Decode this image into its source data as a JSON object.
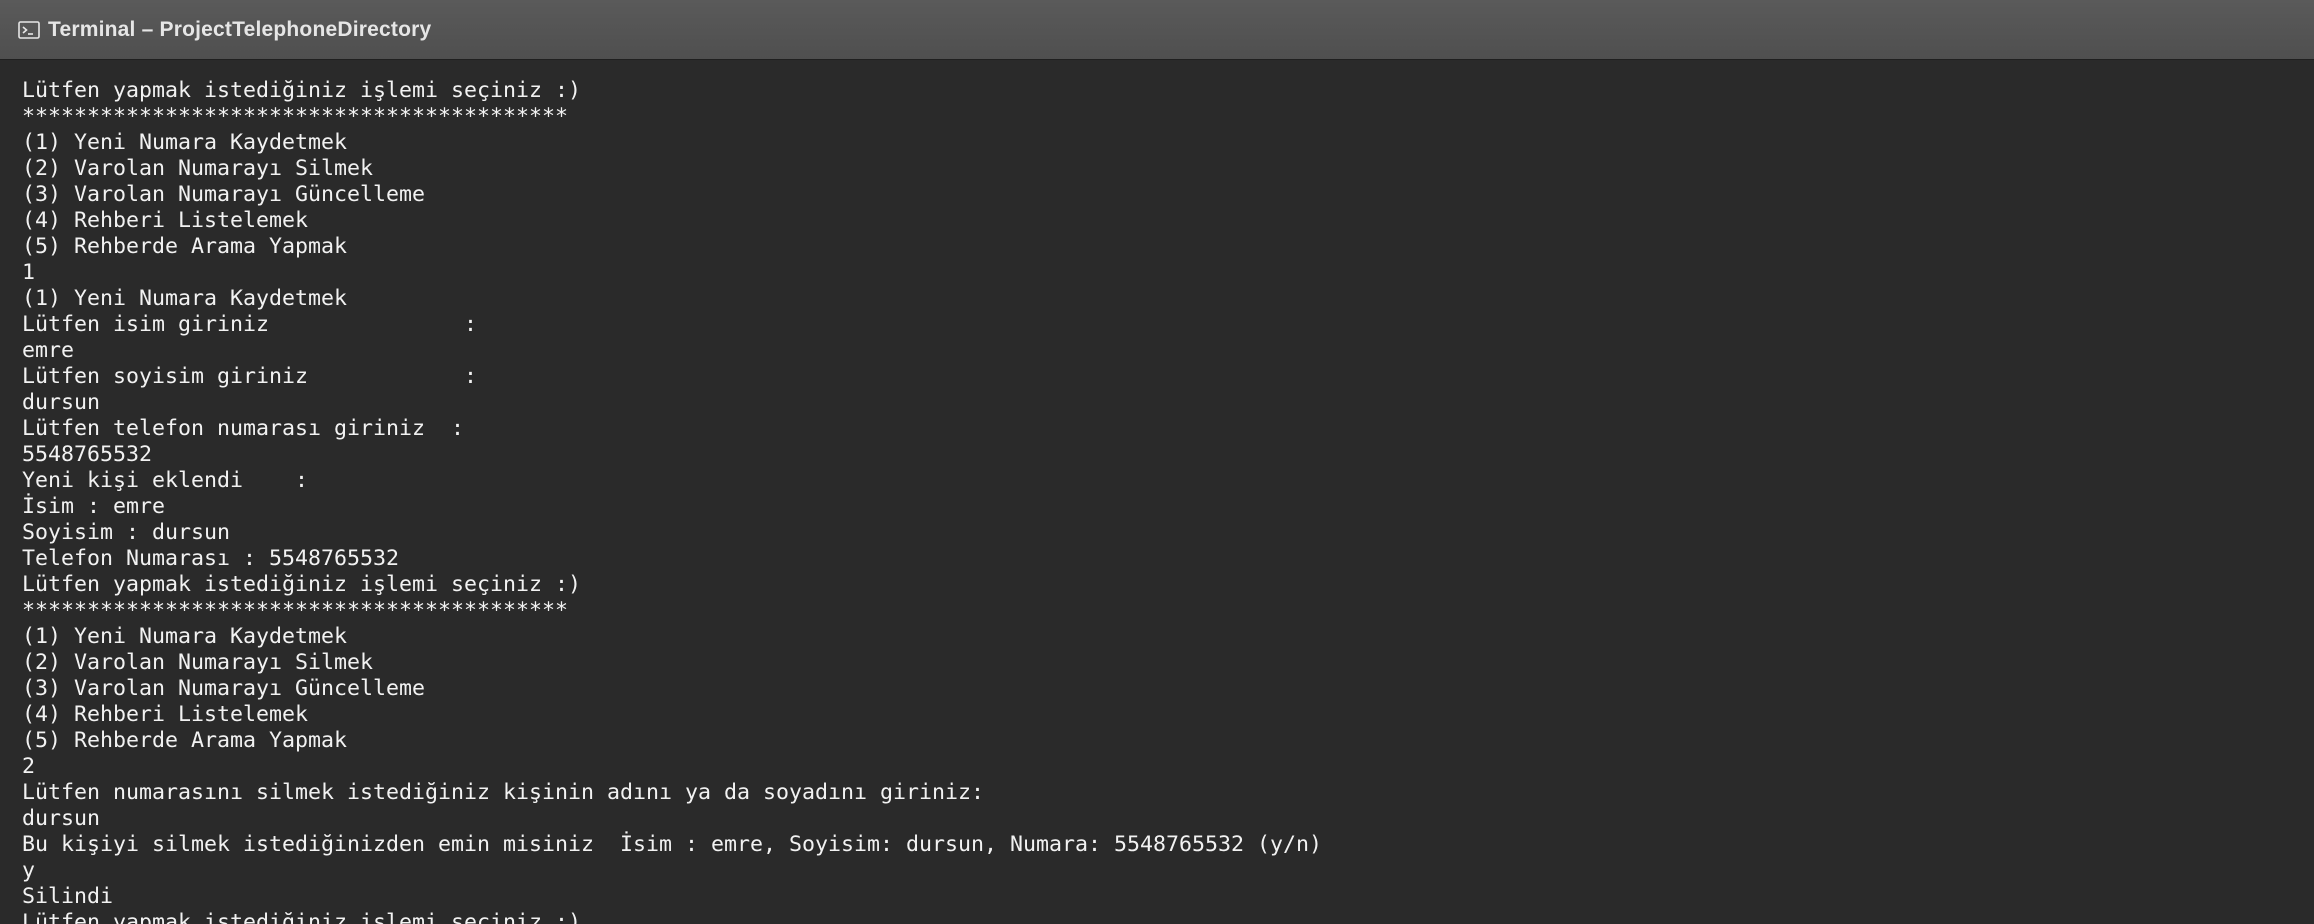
{
  "window": {
    "title": "Terminal – ProjectTelephoneDirectory",
    "icon": "terminal-icon"
  },
  "terminal": {
    "lines": [
      "Lütfen yapmak istediğiniz işlemi seçiniz :)",
      "******************************************",
      "(1) Yeni Numara Kaydetmek",
      "(2) Varolan Numarayı Silmek",
      "(3) Varolan Numarayı Güncelleme",
      "(4) Rehberi Listelemek",
      "(5) Rehberde Arama Yapmak",
      "1",
      "(1) Yeni Numara Kaydetmek",
      "Lütfen isim giriniz               :",
      "emre",
      "Lütfen soyisim giriniz            :",
      "dursun",
      "Lütfen telefon numarası giriniz  :",
      "5548765532",
      "Yeni kişi eklendi    :",
      "İsim : emre",
      "Soyisim : dursun",
      "Telefon Numarası : 5548765532",
      "Lütfen yapmak istediğiniz işlemi seçiniz :)",
      "******************************************",
      "(1) Yeni Numara Kaydetmek",
      "(2) Varolan Numarayı Silmek",
      "(3) Varolan Numarayı Güncelleme",
      "(4) Rehberi Listelemek",
      "(5) Rehberde Arama Yapmak",
      "2",
      "Lütfen numarasını silmek istediğiniz kişinin adını ya da soyadını giriniz:",
      "dursun",
      "Bu kişiyi silmek istediğinizden emin misiniz  İsim : emre, Soyisim: dursun, Numara: 5548765532 (y/n)",
      "y",
      "Silindi",
      "Lütfen yapmak istediğiniz işlemi seçiniz :)"
    ]
  }
}
